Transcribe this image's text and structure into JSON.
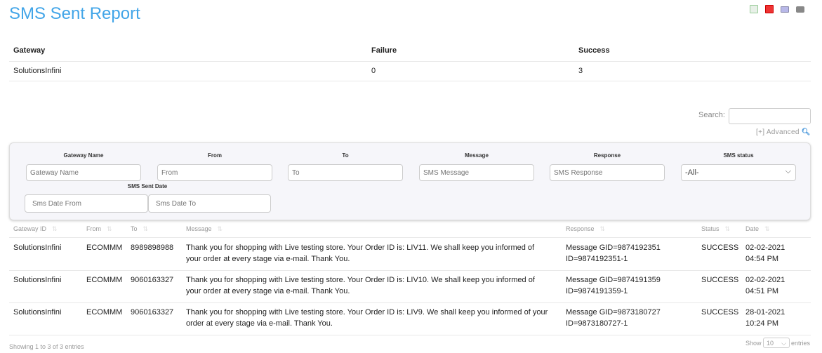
{
  "title": "SMS Sent Report",
  "toolbar": {
    "icons": [
      "excel-icon",
      "pdf-icon",
      "email-icon",
      "print-icon"
    ]
  },
  "summary": {
    "headers": [
      "Gateway",
      "Failure",
      "Success"
    ],
    "row": [
      "SolutionsInfini",
      "0",
      "3"
    ]
  },
  "search": {
    "label": "Search:",
    "value": "",
    "advanced": "[+] Advanced"
  },
  "filters": {
    "labels": [
      "Gateway Name",
      "From",
      "To",
      "Message",
      "Response",
      "SMS status"
    ],
    "placeholders": [
      "Gateway Name",
      "From",
      "To",
      "SMS Message",
      "SMS Response"
    ],
    "status_selected": "-All-",
    "date_label": "SMS Sent Date",
    "date_from": "Sms Date From",
    "date_to": "Sms Date To"
  },
  "table": {
    "headers": [
      "Gateway ID",
      "From",
      "To",
      "Message",
      "Response",
      "Status",
      "Date"
    ],
    "rows": [
      [
        "SolutionsInfini",
        "ECOMMM",
        "8989898988",
        "Thank you for shopping with Live testing store. Your Order ID is: LIV11. We shall keep you informed of your order at every stage via e-mail. Thank You.",
        "Message GID=9874192351 ID=9874192351-1",
        "SUCCESS",
        "02-02-2021 04:54 PM"
      ],
      [
        "SolutionsInfini",
        "ECOMMM",
        "9060163327",
        "Thank you for shopping with Live testing store. Your Order ID is: LIV10. We shall keep you informed of your order at every stage via e-mail. Thank You.",
        "Message GID=9874191359 ID=9874191359-1",
        "SUCCESS",
        "02-02-2021 04:51 PM"
      ],
      [
        "SolutionsInfini",
        "ECOMMM",
        "9060163327",
        "Thank you for shopping with Live testing store. Your Order ID is: LIV9. We shall keep you informed of your order at every stage via e-mail. Thank You.",
        "Message GID=9873180727 ID=9873180727-1",
        "SUCCESS",
        "28-01-2021 10:24 PM"
      ]
    ]
  },
  "footer": {
    "info": "Showing 1 to 3 of 3 entries",
    "show": "Show",
    "page_size": "10",
    "entries": "entries"
  }
}
